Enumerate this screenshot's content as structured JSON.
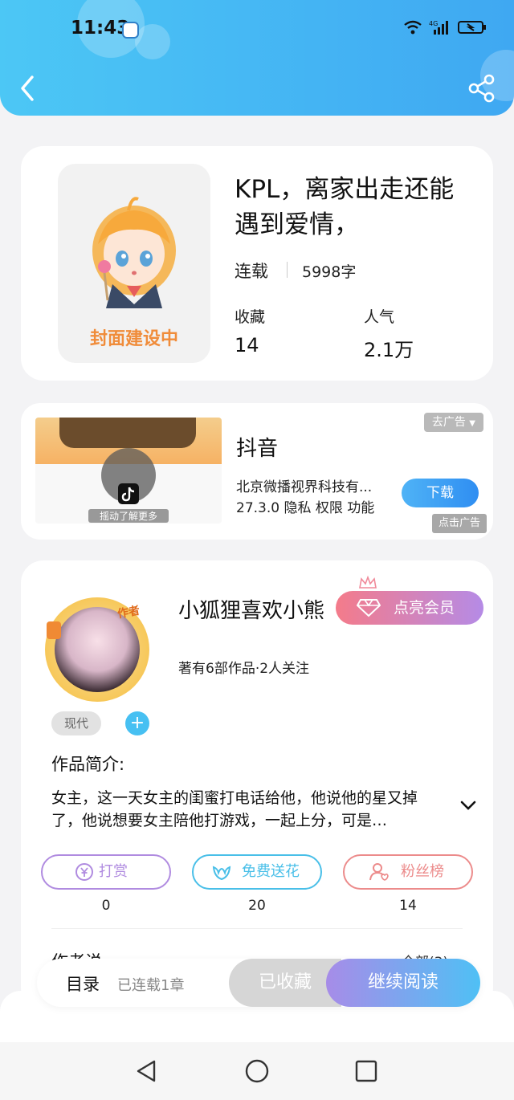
{
  "status_bar": {
    "time": "11:43"
  },
  "book": {
    "title": "KPL，离家出走还能遇到爱情，",
    "cover_text": "封面建设中",
    "status": "连载",
    "word_count": "5998字",
    "stats": [
      {
        "label": "收藏",
        "value": "14"
      },
      {
        "label": "人气",
        "value": "2.1万"
      }
    ]
  },
  "ad": {
    "app_name": "抖音",
    "company": "北京微播视界科技有...",
    "meta": "27.3.0  隐私  权限  功能",
    "close_label": "去广告",
    "download_label": "下载",
    "ad_tag": "点击广告",
    "thumb_hint": "摇动了解更多"
  },
  "author": {
    "name": "小狐狸喜欢小熊",
    "badge": "作者",
    "vip_label": "点亮会员",
    "info": "著有6部作品·2人关注",
    "tag": "现代",
    "add_symbol": "+",
    "intro_label": "作品简介:",
    "intro_text": "女主，这一天女主的闺蜜打电话给他，他说他的星又掉了，他说想要女主陪他打游戏，一起上分，可是…",
    "actions": [
      {
        "label": "打赏",
        "count": "0",
        "color": "#b08be0"
      },
      {
        "label": "免费送花",
        "count": "20",
        "color": "#49bfe8"
      },
      {
        "label": "粉丝榜",
        "count": "14",
        "color": "#ec8b8b"
      }
    ],
    "author_says_label": "作者说",
    "author_says_more": "全部(3)"
  },
  "bottom_bar": {
    "toc_label": "目录",
    "toc_info": "已连载1章",
    "collected_label": "已收藏",
    "continue_label": "继续阅读"
  }
}
